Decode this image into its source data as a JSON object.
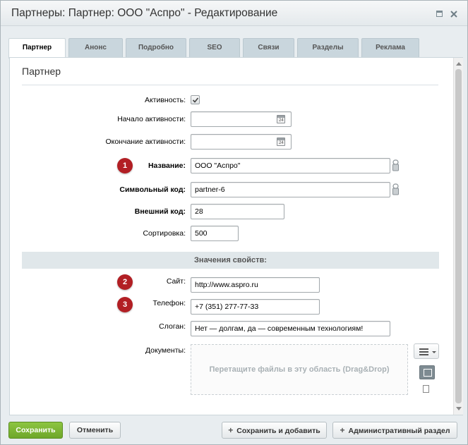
{
  "window": {
    "title": "Партнеры: Партнер: ООО \"Аспро\" - Редактирование"
  },
  "tabs": [
    {
      "label": "Партнер"
    },
    {
      "label": "Анонс"
    },
    {
      "label": "Подробно"
    },
    {
      "label": "SEO"
    },
    {
      "label": "Связи"
    },
    {
      "label": "Разделы"
    },
    {
      "label": "Реклама"
    }
  ],
  "section": {
    "title": "Партнер"
  },
  "form": {
    "active_label": "Активность:",
    "active_checked": true,
    "start_label": "Начало активности:",
    "start_value": "",
    "end_label": "Окончание активности:",
    "end_value": "",
    "name_label": "Название:",
    "name_value": "ООО \"Аспро\"",
    "code_label": "Символьный код:",
    "code_value": "partner-6",
    "ext_label": "Внешний код:",
    "ext_value": "28",
    "sort_label": "Сортировка:",
    "sort_value": "500"
  },
  "props": {
    "header": "Значения свойств:",
    "site_label": "Сайт:",
    "site_value": "http://www.aspro.ru",
    "phone_label": "Телефон:",
    "phone_value": "+7  (351) 277-77-33",
    "slogan_label": "Слоган:",
    "slogan_value": "Нет — долгам, да — современным технологиям!",
    "docs_label": "Документы:",
    "dropzone_text": "Перетащите файлы в эту область (Drag&Drop)"
  },
  "markers": [
    "1",
    "2",
    "3"
  ],
  "footer": {
    "save": "Сохранить",
    "cancel": "Отменить",
    "save_add": "Сохранить и добавить",
    "admin_section": "Административный раздел"
  },
  "colors": {
    "marker": "#b21f24",
    "save_button": "#7bb634",
    "tab_inactive": "#c9d6dd"
  }
}
